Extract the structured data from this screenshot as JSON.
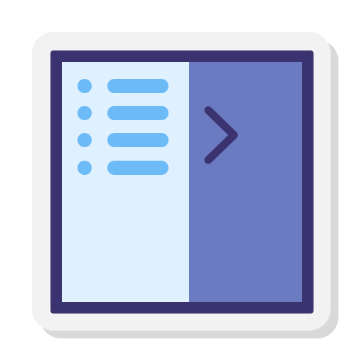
{
  "icon": {
    "name": "sidebar-menu-expand-icon",
    "colors": {
      "sticker_background": "#f2f2f2",
      "sticker_shadow": "#d9d9d9",
      "frame": "#3b3370",
      "sidebar_panel": "#dff0ff",
      "content_panel": "#6b7bc2",
      "menu_items": "#6cbbf7",
      "chevron": "#3b3370"
    },
    "menu_items": [
      {
        "icon": "bullet-dot"
      },
      {
        "icon": "bullet-dot"
      },
      {
        "icon": "bullet-dot"
      },
      {
        "icon": "bullet-dot"
      }
    ],
    "chevron_icon": "chevron-right-icon"
  }
}
